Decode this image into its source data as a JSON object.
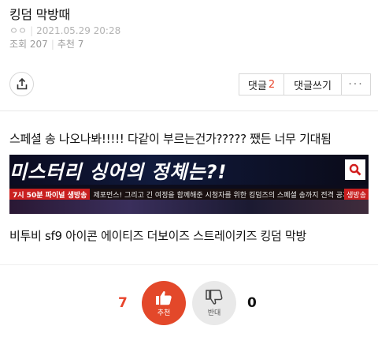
{
  "post": {
    "title": "킹덤 막방때",
    "author": "ㅇㅇ",
    "datetime": "2021.05.29 20:28",
    "views_label": "조회 207",
    "recommend_label": "추천 7"
  },
  "actions": {
    "comment_label": "댓글",
    "comment_count": "2",
    "write_label": "댓글쓰기",
    "more_label": "···"
  },
  "content": {
    "line1": "스페셜 송 나오나봐!!!!! 다같이 부르는건가????? 쨌든 너무 기대됨",
    "banner": {
      "headline": "미스터리 싱어의 정체는?!",
      "strip_left": "7시 50분 파이널 생방송",
      "strip_text": "제포먼스! 그리고 긴 여정을 함께해준 시청자를 위한 킹덤즈의 스페셜 송까지 전격 공개! ▶ 생방송 중",
      "strip_tag": "생방송"
    },
    "line2": "비투비 sf9 아이콘 에이티즈 더보이즈 스트레이키즈 킹덤 막방"
  },
  "votes": {
    "up_count": "7",
    "up_label": "추천",
    "down_label": "반대",
    "down_count": "0"
  },
  "colors": {
    "accent": "#e3482a",
    "muted": "#b3b3b3"
  }
}
